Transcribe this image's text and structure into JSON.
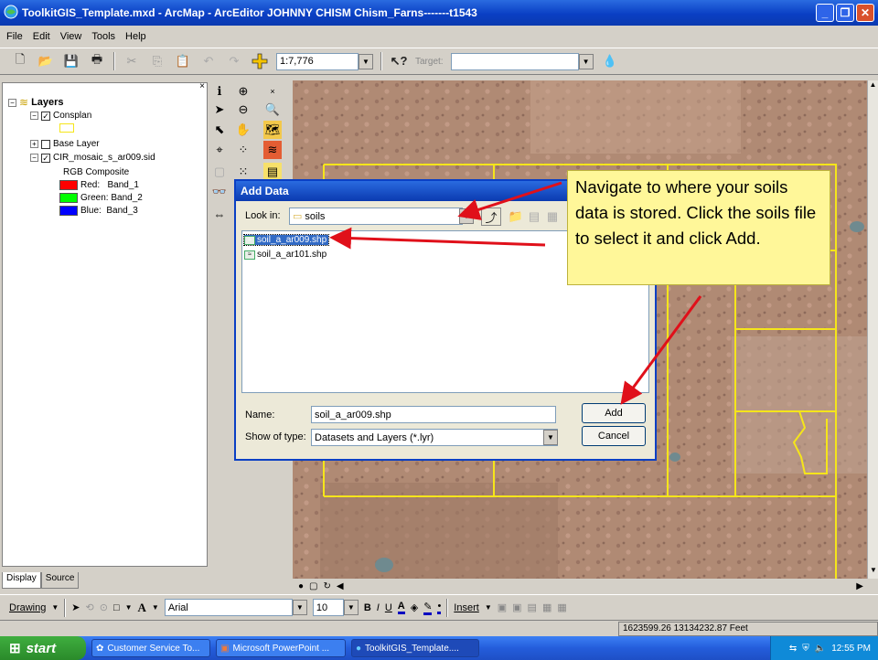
{
  "window": {
    "title": "ToolkitGIS_Template.mxd - ArcMap - ArcEditor       JOHNNY CHISM       Chism_Farns-------t1543"
  },
  "menu": [
    "File",
    "Edit",
    "View",
    "Tools",
    "Help"
  ],
  "toolbar": {
    "scale": "1:7,776",
    "target_label": "Target:"
  },
  "toc": {
    "root": "Layers",
    "layers": [
      {
        "name": "Consplan",
        "checked": true
      },
      {
        "name": "Base Layer",
        "checked": false
      },
      {
        "name": "CIR_mosaic_s_ar009.sid",
        "checked": true
      }
    ],
    "composite": "RGB Composite",
    "bands": [
      {
        "label": "Red:   Band_1",
        "color": "#ff0000"
      },
      {
        "label": "Green: Band_2",
        "color": "#00ff00"
      },
      {
        "label": "Blue:  Band_3",
        "color": "#0000ff"
      }
    ],
    "tabs": [
      "Display",
      "Source"
    ]
  },
  "dialog": {
    "title": "Add Data",
    "look_in_label": "Look in:",
    "look_in_value": "soils",
    "files": [
      "soil_a_ar009.shp",
      "soil_a_ar101.shp"
    ],
    "selected_file": "soil_a_ar009.shp",
    "name_label": "Name:",
    "name_value": "soil_a_ar009.shp",
    "type_label": "Show of type:",
    "type_value": "Datasets and Layers (*.lyr)",
    "add_button": "Add",
    "cancel_button": "Cancel"
  },
  "callout": {
    "text": "Navigate to where your soils data is stored. Click the soils file to select it and click Add."
  },
  "drawing_toolbar": {
    "drawing_label": "Drawing",
    "font": "Arial",
    "font_size": "10",
    "insert_label": "Insert"
  },
  "status": {
    "coordinates": "1623599.26  13134232.87 Feet"
  },
  "taskbar": {
    "start": "start",
    "tasks": [
      "Customer Service To...",
      "Microsoft PowerPoint ...",
      "ToolkitGIS_Template...."
    ],
    "clock": "12:55 PM"
  },
  "colors": {
    "title_blue": "#0a3fc4",
    "callout_yellow": "#fff799",
    "arrow_red": "#e0101a",
    "parcel_yellow": "#f5e51a"
  }
}
